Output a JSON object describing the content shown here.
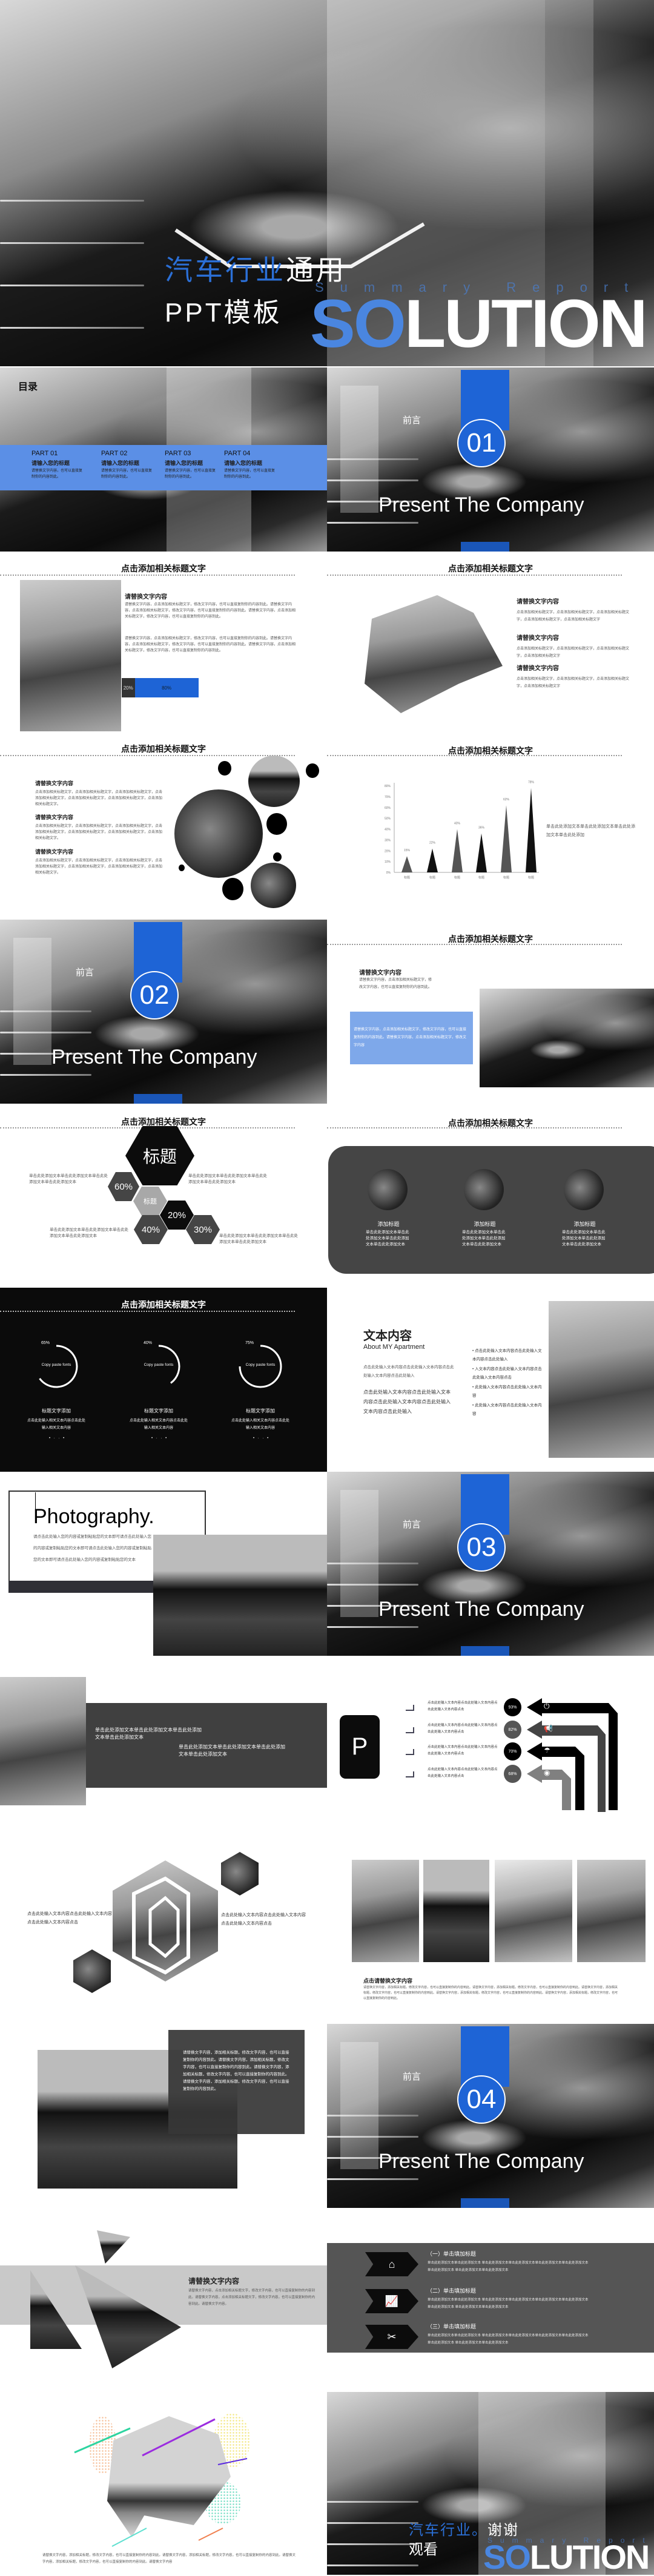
{
  "colors": {
    "accent": "#1e64d6",
    "accent_light": "#5b8fe6",
    "dark": "#454545"
  },
  "cover": {
    "title_blue": "汽车行业",
    "title_white": "通用",
    "subtitle": "PPT模板",
    "summary": "Summary Report",
    "big_blue": "SO",
    "big_white": "LUTION"
  },
  "toc": {
    "title": "目录",
    "parts": [
      {
        "part": "PART 01",
        "title": "请输入您的标题",
        "text": "请替换文字内容，也可以直接复制你的内容到此。"
      },
      {
        "part": "PART 02",
        "title": "请输入您的标题",
        "text": "请替换文字内容，也可以直接复制你的内容到此。"
      },
      {
        "part": "PART 03",
        "title": "请输入您的标题",
        "text": "请替换文字内容，也可以直接复制你的内容到此。"
      },
      {
        "part": "PART 04",
        "title": "请输入您的标题",
        "text": "请替换文字内容，也可以直接复制你的内容到此。"
      }
    ]
  },
  "sections": [
    {
      "label": "前言",
      "num": "01",
      "title": "Present The Company"
    },
    {
      "label": "前言",
      "num": "02",
      "title": "Present The Company"
    },
    {
      "label": "前言",
      "num": "03",
      "title": "Present The Company"
    },
    {
      "label": "前言",
      "num": "04",
      "title": "Present The Company"
    }
  ],
  "slide_title": "点击添加相关标题文字",
  "s3": {
    "heading": "请替换文字内容",
    "para1": "请替换文字内容，点击添加相关标题文字，修改文字内容，也可以直接复制你的内容到此。请替换文字内容，点击添加相关标题文字，修改文字内容，也可以直接复制你的内容到此。请替换文字内容，点击添加相关标题文字，修改文字内容，也可以直接复制你的内容到此。",
    "para2": "请替换文字内容，点击添加相关标题文字，修改文字内容，也可以直接复制你的内容到此。请替换文字内容，点击添加相关标题文字，修改文字内容，也可以直接复制你的内容到此。请替换文字内容，点击添加相关标题文字，修改文字内容，也可以直接复制你的内容到此。",
    "bar_dark": "20%",
    "bar_blue": "80%",
    "progress": 80
  },
  "s4": {
    "items": [
      {
        "heading": "请替换文字内容",
        "text": "点击添加相关标题文字，点击添加相关标题文字，点击添加相关标题文字，点击添加相关标题文字，点击添加相关标题文字"
      },
      {
        "heading": "请替换文字内容",
        "text": "点击添加相关标题文字，点击添加相关标题文字，点击添加相关标题文字，点击添加相关标题文字"
      },
      {
        "heading": "请替换文字内容",
        "text": "点击添加相关标题文字，点击添加相关标题文字，点击添加相关标题文字，点击添加相关标题文字"
      }
    ]
  },
  "s5": {
    "items": [
      {
        "heading": "请替换文字内容",
        "text": "点击添加相关标题文字，点击添加相关标题文字，点击添加相关标题文字，点击添加相关标题文字，点击添加相关标题文字，点击添加相关标题文字，点击添加相关标题文字。"
      },
      {
        "heading": "请替换文字内容",
        "text": "点击添加相关标题文字，点击添加相关标题文字，点击添加相关标题文字，点击添加相关标题文字，点击添加相关标题文字，点击添加相关标题文字，点击添加相关标题文字。"
      },
      {
        "heading": "请替换文字内容",
        "text": "点击添加相关标题文字，点击添加相关标题文字，点击添加相关标题文字，点击添加相关标题文字，点击添加相关标题文字，点击添加相关标题文字，点击添加相关标题文字。"
      }
    ]
  },
  "chart_data": {
    "type": "bar",
    "categories": [
      "标题",
      "标题",
      "标题",
      "标题",
      "标题",
      "标题"
    ],
    "values": [
      15,
      22,
      40,
      36,
      62,
      78
    ],
    "data_labels": [
      "15%",
      "22%",
      "40%",
      "36%",
      "62%",
      "78%"
    ],
    "yticks": [
      "0%",
      "10%",
      "20%",
      "30%",
      "40%",
      "50%",
      "60%",
      "70%",
      "80%"
    ],
    "ylim": [
      0,
      80
    ],
    "bar_shape": "triangle",
    "colors": [
      "#555555",
      "#111111",
      "#555555",
      "#111111",
      "#555555",
      "#111111"
    ],
    "note": "单击此处添加文本单击此处添加文本单击此处添加文本单击此处添加"
  },
  "s8": {
    "heading": "请替换文字内容",
    "text": "请替换文字内容，点击添加相关标题文字，修改文字内容，也可以直接复制你的内容到此。",
    "box": "请替换文字内容，点击添加相关标题文字，修改文字内容，也可以直接复制你的内容到此。请替换文字内容，点击添加相关标题文字，修改文字内容"
  },
  "s9": {
    "big": "标题",
    "small": "标题",
    "pcts": [
      "60%",
      "20%",
      "40%",
      "30%"
    ],
    "texts": [
      "单击此处添加文本单击此处添加文本单击此处添加文本单击此处添加文本",
      "单击此处添加文本单击此处添加文本单击此处添加文本单击此处添加文本",
      "单击此处添加文本单击此处添加文本单击此处添加文本单击此处添加文本",
      "单击此处添加文本单击此处添加文本单击此处添加文本单击此处添加文本"
    ]
  },
  "s10": {
    "items": [
      {
        "title": "添加标题",
        "text": "单击此处添加文本单击此处添加文本单击此处添加文本单击此处添加文本"
      },
      {
        "title": "添加标题",
        "text": "单击此处添加文本单击此处添加文本单击此处添加文本单击此处添加文本"
      },
      {
        "title": "添加标题",
        "text": "单击此处添加文本单击此处添加文本单击此处添加文本单击此处添加文本"
      }
    ]
  },
  "s11": {
    "items": [
      {
        "pct": "65%",
        "value": 65,
        "center": "Copy paste fonts",
        "title": "标题文字添加",
        "text": "点击此处输入相关文本内容点击此处输入相关文本内容"
      },
      {
        "pct": "40%",
        "value": 40,
        "center": "Copy paste fonts",
        "title": "标题文字添加",
        "text": "点击此处输入相关文本内容点击此处输入相关文本内容"
      },
      {
        "pct": "75%",
        "value": 75,
        "center": "Copy paste fonts",
        "title": "标题文字添加",
        "text": "点击此处输入相关文本内容点击此处输入相关文本内容"
      }
    ]
  },
  "s12": {
    "heading": "文本内容",
    "sub": "About MY Apartment",
    "p1": "点击此处输入文本内容点击此处输入文本内容点击此处输入文本内容点击此处输入",
    "p2": "点击此处输入文本内容点击此处输入文本内容点击此处输入文本内容点击此处输入文本内容点击此处输入",
    "bullets": [
      "点击此处输入文本内容点击此处输入文本内容点击此处输入",
      "入文本内容点击此处输入文本内容点击此处输入文本内容点击",
      "此处输入文本内容点击此处输入文本内容",
      "此处输入文本内容点击此处输入文本内容"
    ]
  },
  "s13": {
    "heading": "Photography.",
    "text": "请点击此处输入您的内容或复制粘贴您的文本即可请点击此处输入您的内容或复制粘贴您的文本即可请点击此处输入您的内容或复制粘贴您的文本即可请点击此处输入您的内容或复制粘贴您的文本"
  },
  "s15": {
    "t1": "单击此处添加文本单击此处添加文本单击此处添加文本单击此处添加文本",
    "t2": "单击此处添加文本单击此处添加文本单击此处添加文本单击此处添加文本"
  },
  "s16": {
    "logo": "P",
    "items": [
      {
        "pct": "93%",
        "icon": "power-icon",
        "text": "点击此处输入文本内容点击此处输入文本内容点击此处输入文本内容点击"
      },
      {
        "pct": "82%",
        "icon": "megaphone-icon",
        "text": "点击此处输入文本内容点击此处输入文本内容点击此处输入文本内容点击"
      },
      {
        "pct": "70%",
        "icon": "umbrella-icon",
        "text": "点击此处输入文本内容点击此处输入文本内容点击此处输入文本内容点击"
      },
      {
        "pct": "68%",
        "icon": "disc-icon",
        "text": "点击此处输入文本内容点击此处输入文本内容点击此处输入文本内容点击"
      }
    ]
  },
  "s17": {
    "t1": "点击此处输入文本内容点击此处输入文本内容点击此处输入文本内容点击",
    "t2": "点击此处输入文本内容点击此处输入文本内容点击此处输入文本内容点击"
  },
  "s18": {
    "heading": "点击请替换文字内容",
    "text": "请替换文字内容，添加相关标题，修改文字内容，也可以直接复制你的内容到此。请替换文字内容，添加相关标题，修改文字内容，也可以直接复制你的内容到此。请替换文字内容，添加相关标题，修改文字内容，也可以直接复制你的内容到此。请替换文字内容，添加相关标题，修改文字内容，也可以直接复制你的内容到此。请替换文字内容，添加相关标题，修改文字内容，也可以直接复制你的内容到此。"
  },
  "s19": {
    "text": "请替换文字内容，添加相关标题，修改文字内容，也可以直接复制你的内容到此。请替换文字内容，添加相关标题，修改文字内容，也可以直接复制你的内容到此。请替换文字内容，添加相关标题，修改文字内容，也可以直接复制你的内容到此。请替换文字内容，添加相关标题，修改文字内容，也可以直接复制你的内容到此。"
  },
  "s21": {
    "heading": "请替换文字内容",
    "text": "请替换文字内容，点击添加相关标题文字，修改文字内容，也可以直接复制你的内容到此。请替换文字内容，点击添加相关标题文字，修改文字内容，也可以直接复制你的内容到此。请替换文字内容。"
  },
  "s22": {
    "items": [
      {
        "title": "（一）单击填加标题",
        "icon": "home-icon",
        "text": "单击此处添加文本单击此处添加文本 单击此处添加文本单击此处添加文本单击此处添加文本单击此处添加文本单击此处添加文本 单击此处添加文本单击此处添加文本"
      },
      {
        "title": "（二）单击填加标题",
        "icon": "chart-icon",
        "text": "单击此处添加文本单击此处添加文本 单击此处添加文本单击此处添加文本单击此处添加文本单击此处添加文本单击此处添加文本 单击此处添加文本单击此处添加文本"
      },
      {
        "title": "（三）单击填加标题",
        "icon": "tools-icon",
        "text": "单击此处添加文本单击此处添加文本 单击此处添加文本单击此处添加文本单击此处添加文本单击此处添加文本单击此处添加文本 单击此处添加文本单击此处添加文本"
      }
    ]
  },
  "s23": {
    "text": "请替换文字内容，添加相关标题，修改文字内容，也可以直接复制你的内容到此。请替换文字内容，添加相关标题，修改文字内容，也可以直接复制你的内容到此。请替换文字内容，添加相关标题，修改文字内容，也可以直接复制你的内容到此。请替换文字内容"
  },
  "end": {
    "blue": "汽车行业。",
    "white1": "谢谢",
    "white2": "观看",
    "summary": "Summary Report",
    "big_blue": "SO",
    "big_white": "LUTION"
  }
}
